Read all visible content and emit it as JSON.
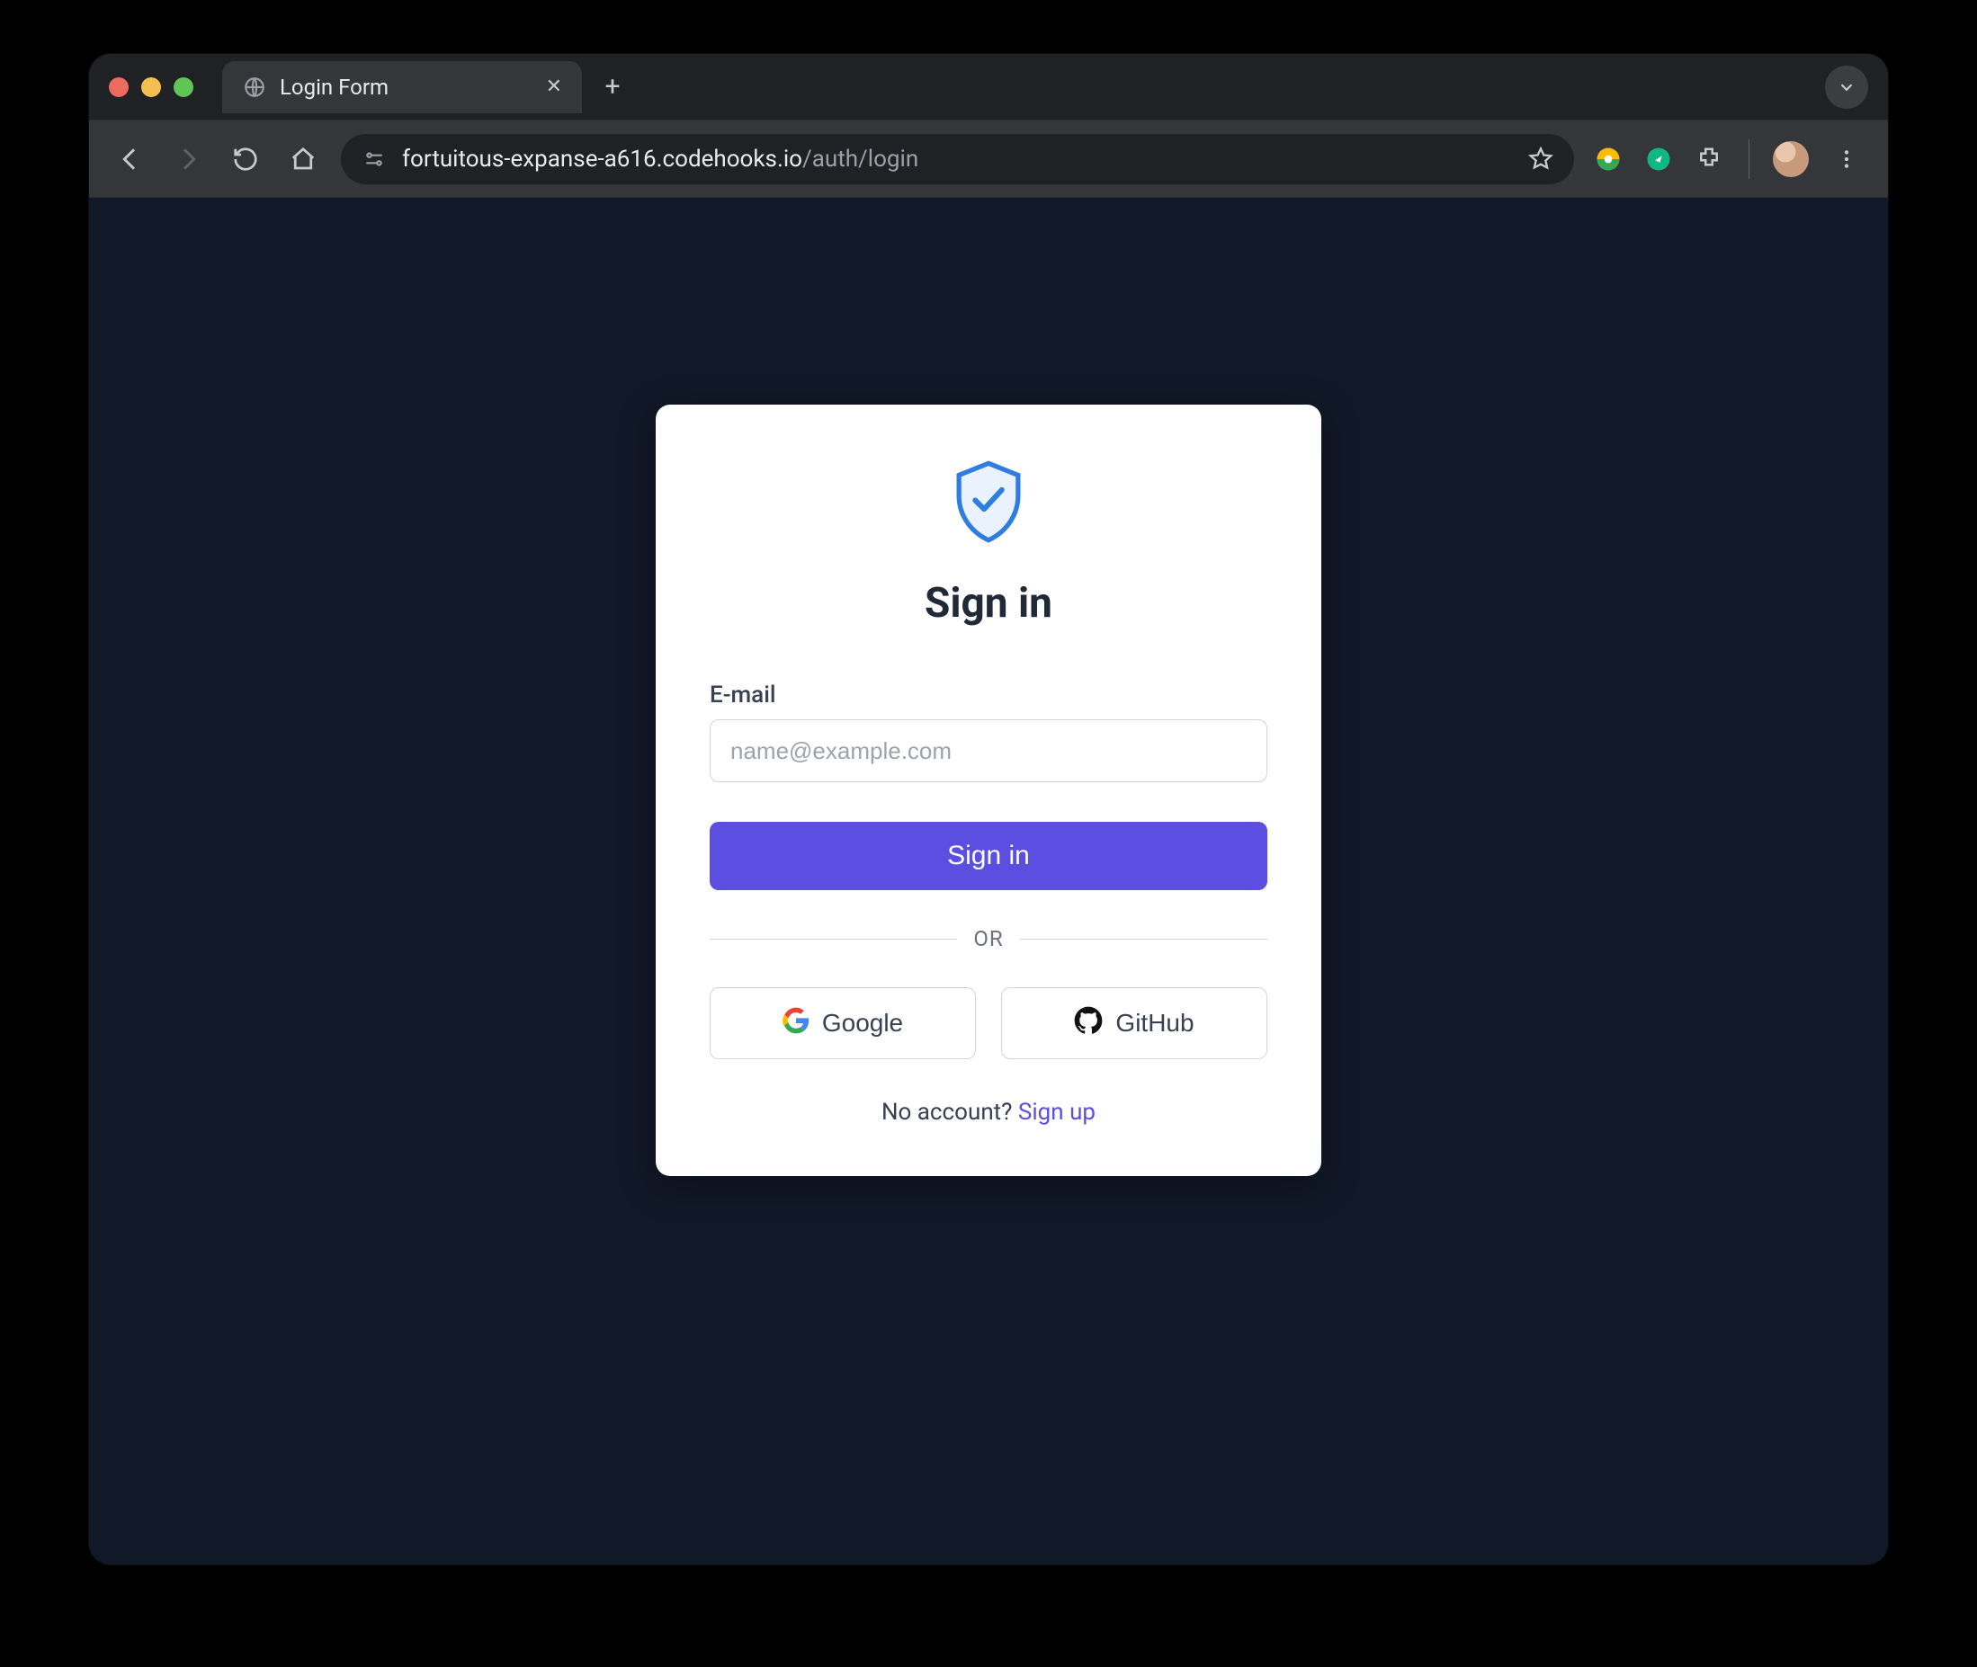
{
  "browser": {
    "tab_title": "Login Form",
    "url_host": "fortuitous-expanse-a616.codehooks.io",
    "url_path": "/auth/login"
  },
  "card": {
    "title": "Sign in",
    "email_label": "E-mail",
    "email_placeholder": "name@example.com",
    "submit_label": "Sign in",
    "or_label": "OR",
    "google_label": "Google",
    "github_label": "GitHub",
    "no_account_text": "No account? ",
    "signup_label": "Sign up"
  },
  "colors": {
    "page_bg": "#111827",
    "accent": "#5b4ee0"
  }
}
